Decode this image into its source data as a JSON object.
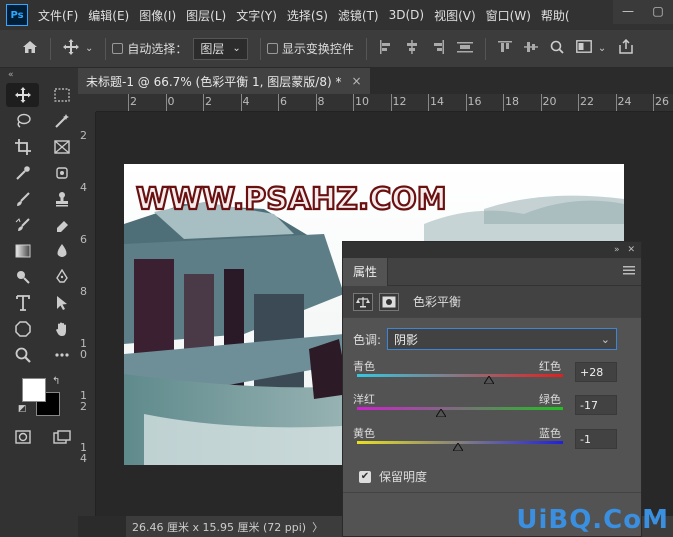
{
  "app": {
    "logo": "Ps"
  },
  "menu": [
    "文件(F)",
    "编辑(E)",
    "图像(I)",
    "图层(L)",
    "文字(Y)",
    "选择(S)",
    "滤镜(T)",
    "3D(D)",
    "视图(V)",
    "窗口(W)",
    "帮助("
  ],
  "window_controls": {
    "minimize": "—",
    "maximize": "▢"
  },
  "options": {
    "auto_select_label": "自动选择：",
    "auto_select_value": "图层",
    "show_transform_label": "显示变换控件"
  },
  "document": {
    "tab_title": "未标题-1 @ 66.7% (色彩平衡 1, 图层蒙版/8) *",
    "close": "×",
    "status": "26.46 厘米 x 15.95 厘米 (72 ppi)",
    "status_arrow": "〉"
  },
  "ruler": {
    "top": [
      "2",
      "0",
      "2",
      "4",
      "6",
      "8",
      "10",
      "12",
      "14",
      "16",
      "18",
      "20",
      "22",
      "24",
      "26"
    ],
    "left": [
      "2",
      "4",
      "6",
      "8",
      "1\n0",
      "1\n2",
      "1\n4"
    ]
  },
  "image": {
    "watermark": "WWW.PSAHZ.COM"
  },
  "properties": {
    "tab": "属性",
    "adjustment_name": "色彩平衡",
    "tone_label": "色调:",
    "tone_value": "阴影",
    "sliders": [
      {
        "left": "青色",
        "right": "红色",
        "value": "+28",
        "position": 0.64,
        "from": "#34c8e0",
        "to": "#e02020"
      },
      {
        "left": "洋红",
        "right": "绿色",
        "value": "-17",
        "position": 0.41,
        "from": "#d020d0",
        "to": "#20c020"
      },
      {
        "left": "黄色",
        "right": "蓝色",
        "value": "-1",
        "position": 0.49,
        "from": "#e8e020",
        "to": "#2020e0"
      }
    ],
    "preserve_label": "保留明度",
    "preserve_checked": "✔"
  },
  "corner_watermark": "UiBQ.CoM"
}
